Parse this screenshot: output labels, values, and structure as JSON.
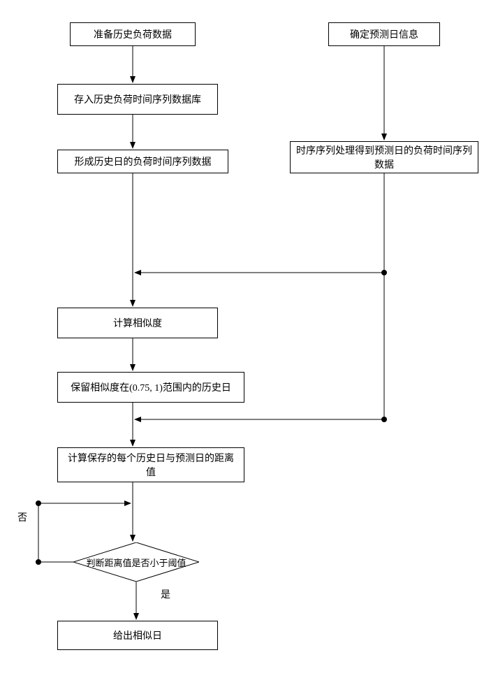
{
  "flowchart": {
    "boxes": {
      "prepare_history": "准备历史负荷数据",
      "determine_forecast": "确定预测日信息",
      "store_db": "存入历史负荷时间序列数据库",
      "form_history_series": "形成历史日的负荷时间序列数据",
      "process_forecast_series": "时序序列处理得到预测日的负荷时间序列数据",
      "calc_similarity": "计算相似度",
      "keep_range": "保留相似度在(0.75, 1)范围内的历史日",
      "calc_distance": "计算保存的每个历史日与预测日的距离值",
      "decision": "判断距离值是否小于阈值",
      "output": "给出相似日"
    },
    "labels": {
      "no": "否",
      "yes": "是"
    }
  }
}
